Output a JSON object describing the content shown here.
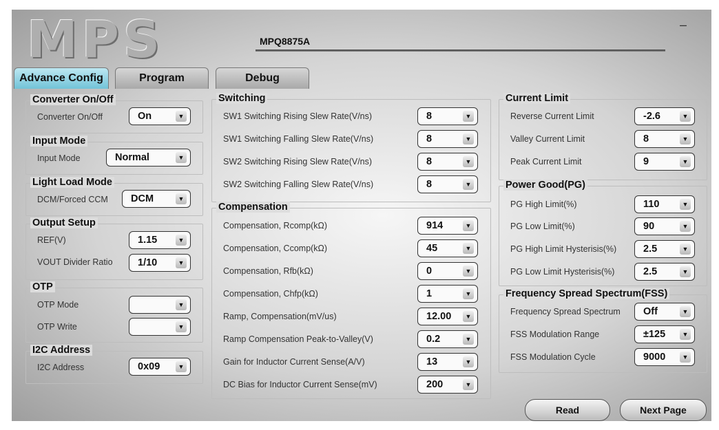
{
  "header": {
    "logo": "MPS",
    "product": "MPQ8875A",
    "minimize": "–"
  },
  "tabs": [
    {
      "label": "Advance Config",
      "active": true
    },
    {
      "label": "Program",
      "active": false
    },
    {
      "label": "Debug",
      "active": false
    }
  ],
  "groups": {
    "converter": {
      "title": "Converter On/Off",
      "label": "Converter On/Off",
      "value": "On"
    },
    "input_mode": {
      "title": "Input Mode",
      "label": "Input Mode",
      "value": "Normal"
    },
    "light_load": {
      "title": "Light Load Mode",
      "label": "DCM/Forced CCM",
      "value": "DCM"
    },
    "output_setup": {
      "title": "Output Setup",
      "ref_label": "REF(V)",
      "ref_value": "1.15",
      "ratio_label": "VOUT Divider Ratio",
      "ratio_value": "1/10"
    },
    "otp": {
      "title": "OTP",
      "mode_label": "OTP Mode",
      "mode_value": "",
      "write_label": "OTP Write",
      "write_value": ""
    },
    "i2c": {
      "title": "I2C Address",
      "label": "I2C Address",
      "value": "0x09"
    },
    "switching": {
      "title": "Switching",
      "rows": [
        {
          "label": "SW1 Switching Rising Slew Rate(V/ns)",
          "value": "8"
        },
        {
          "label": "SW1 Switching Falling Slew Rate(V/ns)",
          "value": "8"
        },
        {
          "label": "SW2 Switching Rising Slew Rate(V/ns)",
          "value": "8"
        },
        {
          "label": "SW2 Switching Falling Slew Rate(V/ns)",
          "value": "8"
        }
      ]
    },
    "compensation": {
      "title": "Compensation",
      "rows": [
        {
          "label": "Compensation, Rcomp(kΩ)",
          "value": "914"
        },
        {
          "label": "Compensation, Ccomp(kΩ)",
          "value": "45"
        },
        {
          "label": "Compensation, Rfb(kΩ)",
          "value": "0"
        },
        {
          "label": "Compensation, Chfp(kΩ)",
          "value": "1"
        },
        {
          "label": "Ramp, Compensation(mV/us)",
          "value": "12.00"
        },
        {
          "label": "Ramp Compensation Peak-to-Valley(V)",
          "value": "0.2"
        },
        {
          "label": "Gain for Inductor Current Sense(A/V)",
          "value": "13"
        },
        {
          "label": "DC Bias for Inductor Current Sense(mV)",
          "value": "200"
        }
      ]
    },
    "current_limit": {
      "title": "Current Limit",
      "rows": [
        {
          "label": "Reverse Current Limit",
          "value": "-2.6"
        },
        {
          "label": "Valley Current Limit",
          "value": "8"
        },
        {
          "label": "Peak Current Limit",
          "value": "9"
        }
      ]
    },
    "power_good": {
      "title": "Power Good(PG)",
      "rows": [
        {
          "label": "PG High Limit(%)",
          "value": "110"
        },
        {
          "label": "PG Low Limit(%)",
          "value": "90"
        },
        {
          "label": "PG High Limit Hysterisis(%)",
          "value": "2.5"
        },
        {
          "label": "PG Low Limit Hysterisis(%)",
          "value": "2.5"
        }
      ]
    },
    "fss": {
      "title": "Frequency Spread Spectrum(FSS)",
      "rows": [
        {
          "label": "Frequency Spread Spectrum",
          "value": "Off"
        },
        {
          "label": "FSS Modulation Range",
          "value": "±125"
        },
        {
          "label": "FSS Modulation Cycle",
          "value": "9000"
        }
      ]
    }
  },
  "buttons": {
    "read": "Read",
    "next_page": "Next Page"
  },
  "icons": {
    "dropdown_arrow": "▼"
  },
  "colors": {
    "active_tab": "#72c3d8"
  }
}
